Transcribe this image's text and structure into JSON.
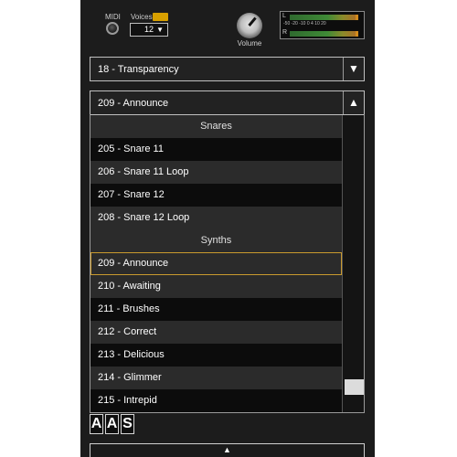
{
  "header": {
    "midi_label": "MIDI",
    "voices_label": "Voices",
    "voices_badge": "",
    "voices_value": "12",
    "voices_arrow": "▼",
    "volume_label": "Volume",
    "meter": {
      "left_channel": "L",
      "right_channel": "R",
      "scale": "-50 -20   -10     0  4  10   20",
      "left_level": 0.97,
      "right_level": 0.97
    }
  },
  "preset": {
    "label": "18 - Transparency",
    "arrow": "▼"
  },
  "sound": {
    "label": "209 - Announce",
    "arrow": "▲"
  },
  "list": [
    {
      "type": "header",
      "label": "Snares"
    },
    {
      "type": "item",
      "label": "205 - Snare 11"
    },
    {
      "type": "item",
      "label": "206 - Snare 11 Loop"
    },
    {
      "type": "item",
      "label": "207 - Snare 12"
    },
    {
      "type": "item",
      "label": "208 - Snare 12 Loop"
    },
    {
      "type": "header",
      "label": "Synths"
    },
    {
      "type": "item",
      "label": "209 - Announce",
      "selected": true
    },
    {
      "type": "item",
      "label": "210 - Awaiting"
    },
    {
      "type": "item",
      "label": "211 - Brushes"
    },
    {
      "type": "item",
      "label": "212 - Correct"
    },
    {
      "type": "item",
      "label": "213 - Delicious"
    },
    {
      "type": "item",
      "label": "214 - Glimmer"
    },
    {
      "type": "item",
      "label": "215 - Intrepid"
    }
  ],
  "logo": [
    "A",
    "A",
    "S"
  ],
  "bottom": {
    "arrow": "▲"
  },
  "colors": {
    "selection_border": "#c99a2e",
    "badge": "#d8a000",
    "background": "#1c1c1c"
  }
}
